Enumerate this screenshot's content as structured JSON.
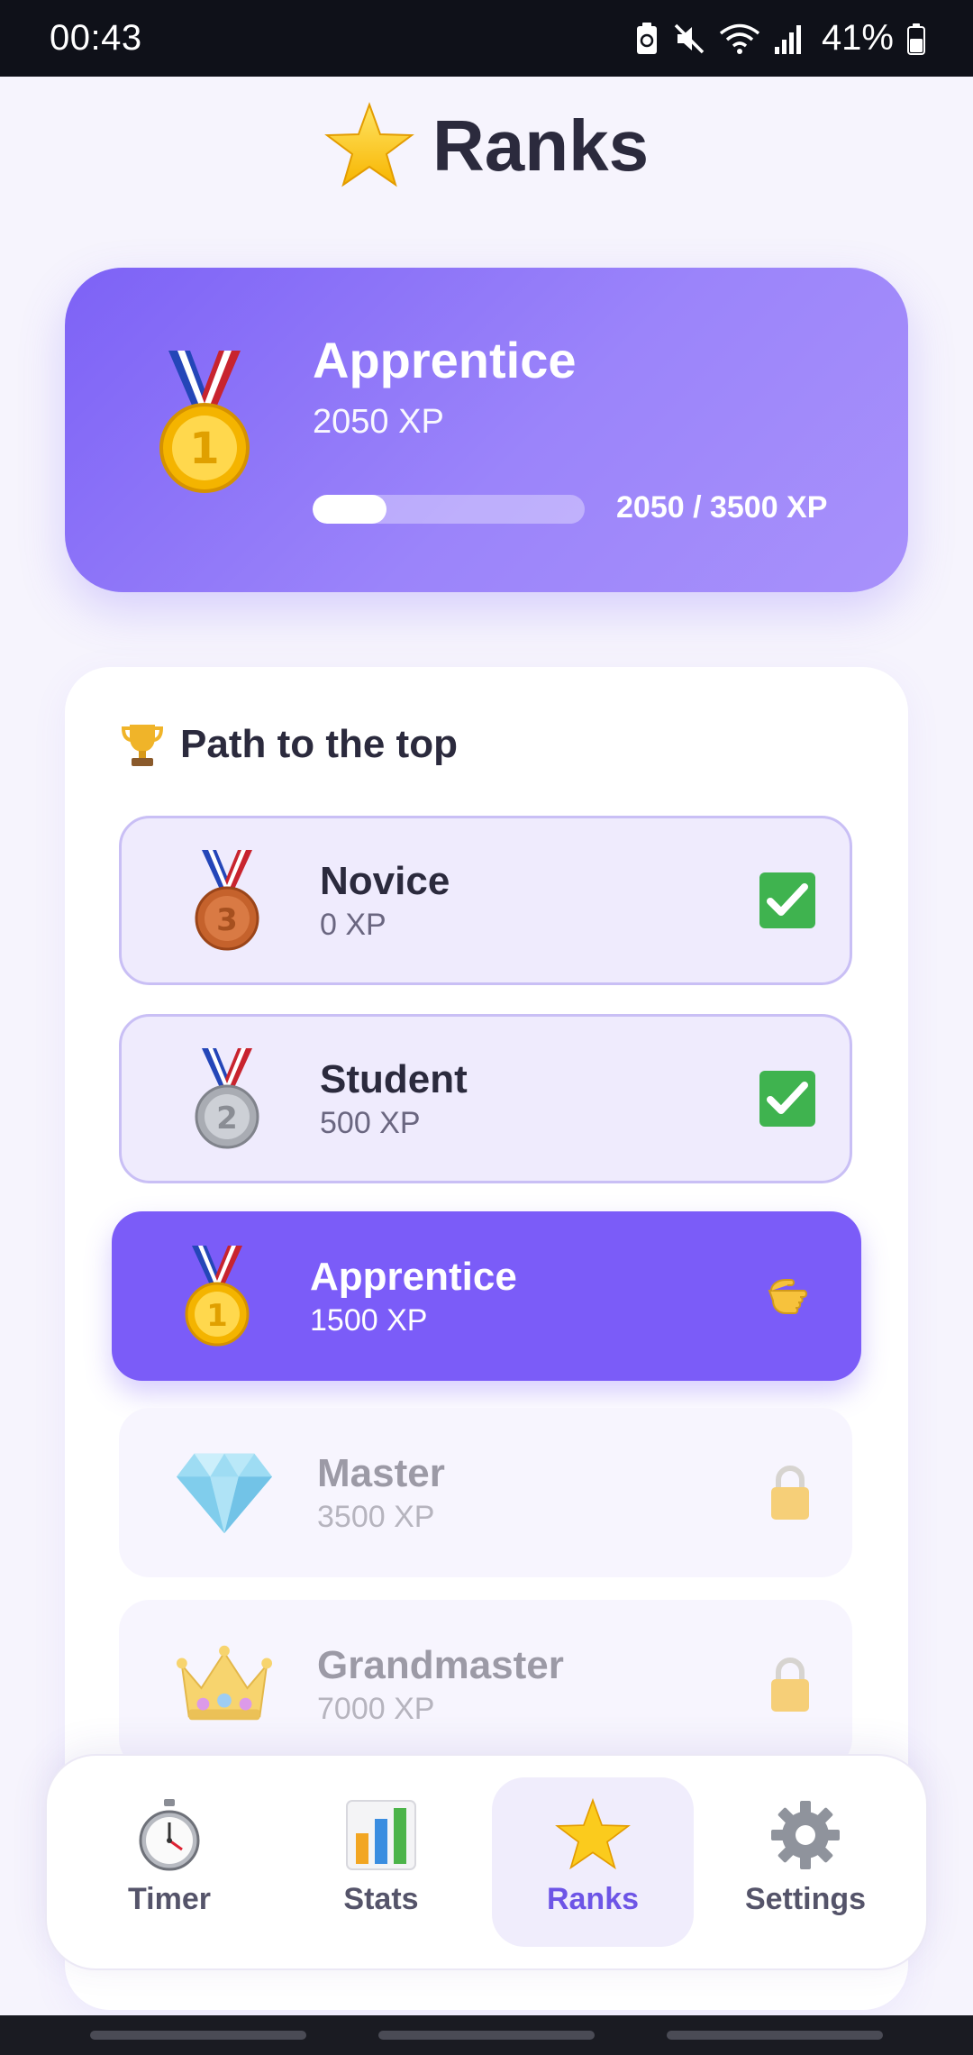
{
  "status_bar": {
    "time": "00:43",
    "battery": "41%"
  },
  "header": {
    "title": "Ranks",
    "icon": "star-icon"
  },
  "current_rank": {
    "name": "Apprentice",
    "xp": "2050 XP",
    "progress_text": "2050 / 3500 XP",
    "progress_fraction": 0.27,
    "icon": "gold-medal-icon",
    "gradient_colors": [
      "#7d62f6",
      "#a891fb"
    ]
  },
  "path": {
    "title": "Path to the top",
    "icon": "trophy-icon",
    "ranks": [
      {
        "name": "Novice",
        "xp": "0 XP",
        "icon": "bronze-medal-icon",
        "status": "completed"
      },
      {
        "name": "Student",
        "xp": "500 XP",
        "icon": "silver-medal-icon",
        "status": "completed"
      },
      {
        "name": "Apprentice",
        "xp": "1500 XP",
        "icon": "gold-medal-icon",
        "status": "current"
      },
      {
        "name": "Master",
        "xp": "3500 XP",
        "icon": "diamond-icon",
        "status": "locked"
      },
      {
        "name": "Grandmaster",
        "xp": "7000 XP",
        "icon": "crown-icon",
        "status": "locked"
      }
    ]
  },
  "bottom_nav": {
    "items": [
      {
        "label": "Timer",
        "icon": "stopwatch-icon",
        "active": false
      },
      {
        "label": "Stats",
        "icon": "bar-chart-icon",
        "active": false
      },
      {
        "label": "Ranks",
        "icon": "star-icon",
        "active": true
      },
      {
        "label": "Settings",
        "icon": "gear-icon",
        "active": false
      }
    ]
  },
  "colors": {
    "accent": "#7b5cf8",
    "background": "#f6f4fd",
    "check_green": "#39b54a"
  }
}
